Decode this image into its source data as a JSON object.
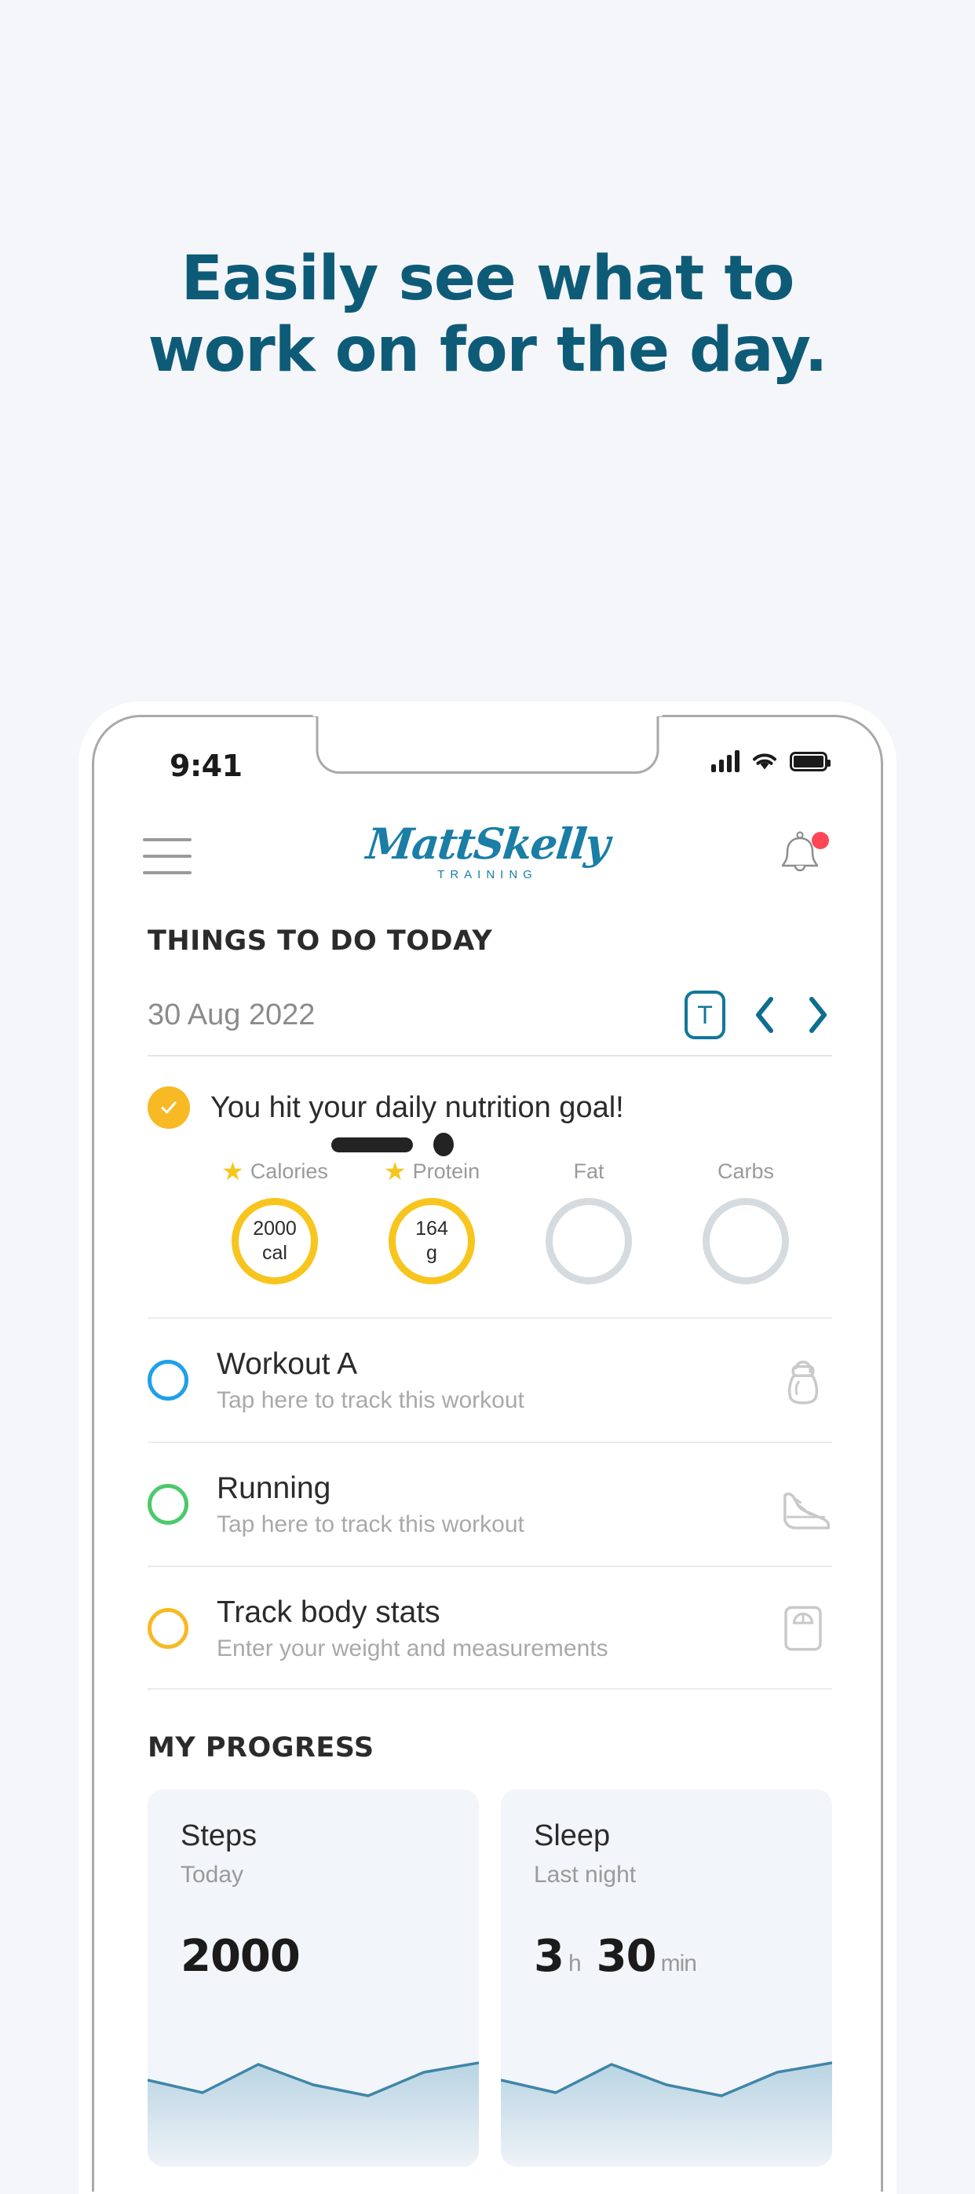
{
  "promo": {
    "line1": "Easily see what to",
    "line2": "work on for the day.",
    "accent_color": "#0e5b78",
    "background_color": "#f4f6fa"
  },
  "status_bar": {
    "time": "9:41",
    "signal_icon": "signal-bars-icon",
    "wifi_icon": "wifi-icon",
    "battery_icon": "battery-full-icon"
  },
  "app_header": {
    "menu_icon": "hamburger-menu-icon",
    "logo_script": "MattSkelly",
    "logo_subtitle": "TRAINING",
    "logo_color": "#1a7ea6",
    "bell_icon": "notification-bell-icon",
    "bell_badge_color": "#ff4757"
  },
  "today": {
    "section_title": "THINGS TO DO TODAY",
    "date": "30 Aug 2022",
    "today_button": "T",
    "prev_icon": "chevron-left-icon",
    "next_icon": "chevron-right-icon"
  },
  "nutrition": {
    "check_icon": "check-circle-icon",
    "message": "You hit your daily nutrition goal!",
    "accent_color": "#f7c51e",
    "macros": [
      {
        "label": "Calories",
        "starred": true,
        "value": "2000",
        "unit": "cal",
        "filled": true
      },
      {
        "label": "Protein",
        "starred": true,
        "value": "164",
        "unit": "g",
        "filled": true
      },
      {
        "label": "Fat",
        "starred": false,
        "value": "",
        "unit": "",
        "filled": false
      },
      {
        "label": "Carbs",
        "starred": false,
        "value": "",
        "unit": "",
        "filled": false
      }
    ]
  },
  "tasks": [
    {
      "title": "Workout A",
      "subtitle": "Tap here to track this workout",
      "circle_color": "#20a0e8",
      "icon": "kettlebell-icon"
    },
    {
      "title": "Running",
      "subtitle": "Tap here to track this workout",
      "circle_color": "#4cc96a",
      "icon": "running-shoe-icon"
    },
    {
      "title": "Track body stats",
      "subtitle": "Enter your weight and measurements",
      "circle_color": "#f7b924",
      "icon": "weighing-scale-icon"
    }
  ],
  "progress": {
    "section_title": "MY PROGRESS",
    "cards": [
      {
        "title": "Steps",
        "subtitle": "Today",
        "value": "2000",
        "unit": "",
        "value2": "",
        "unit2": ""
      },
      {
        "title": "Sleep",
        "subtitle": "Last night",
        "value": "3",
        "unit": "h",
        "value2": "30",
        "unit2": "min"
      }
    ]
  },
  "chart_data": [
    {
      "type": "area",
      "title": "Steps",
      "x": [
        0,
        1,
        2,
        3,
        4,
        5,
        6
      ],
      "values": [
        58,
        44,
        75,
        62,
        52,
        70,
        78
      ],
      "series": [
        {
          "name": "Steps",
          "values": [
            58,
            44,
            75,
            62,
            52,
            70,
            78
          ]
        }
      ],
      "line_color": "#3f86a8",
      "fill_color": "#bcd6e4",
      "xlabel": "",
      "ylabel": "",
      "grid": false,
      "legend": "none"
    },
    {
      "type": "area",
      "title": "Sleep",
      "x": [
        0,
        1,
        2,
        3,
        4,
        5,
        6
      ],
      "values": [
        58,
        44,
        75,
        62,
        52,
        70,
        78
      ],
      "series": [
        {
          "name": "Sleep",
          "values": [
            58,
            44,
            75,
            62,
            52,
            70,
            78
          ]
        }
      ],
      "line_color": "#3f86a8",
      "fill_color": "#bcd6e4",
      "xlabel": "",
      "ylabel": "",
      "grid": false,
      "legend": "none"
    }
  ]
}
